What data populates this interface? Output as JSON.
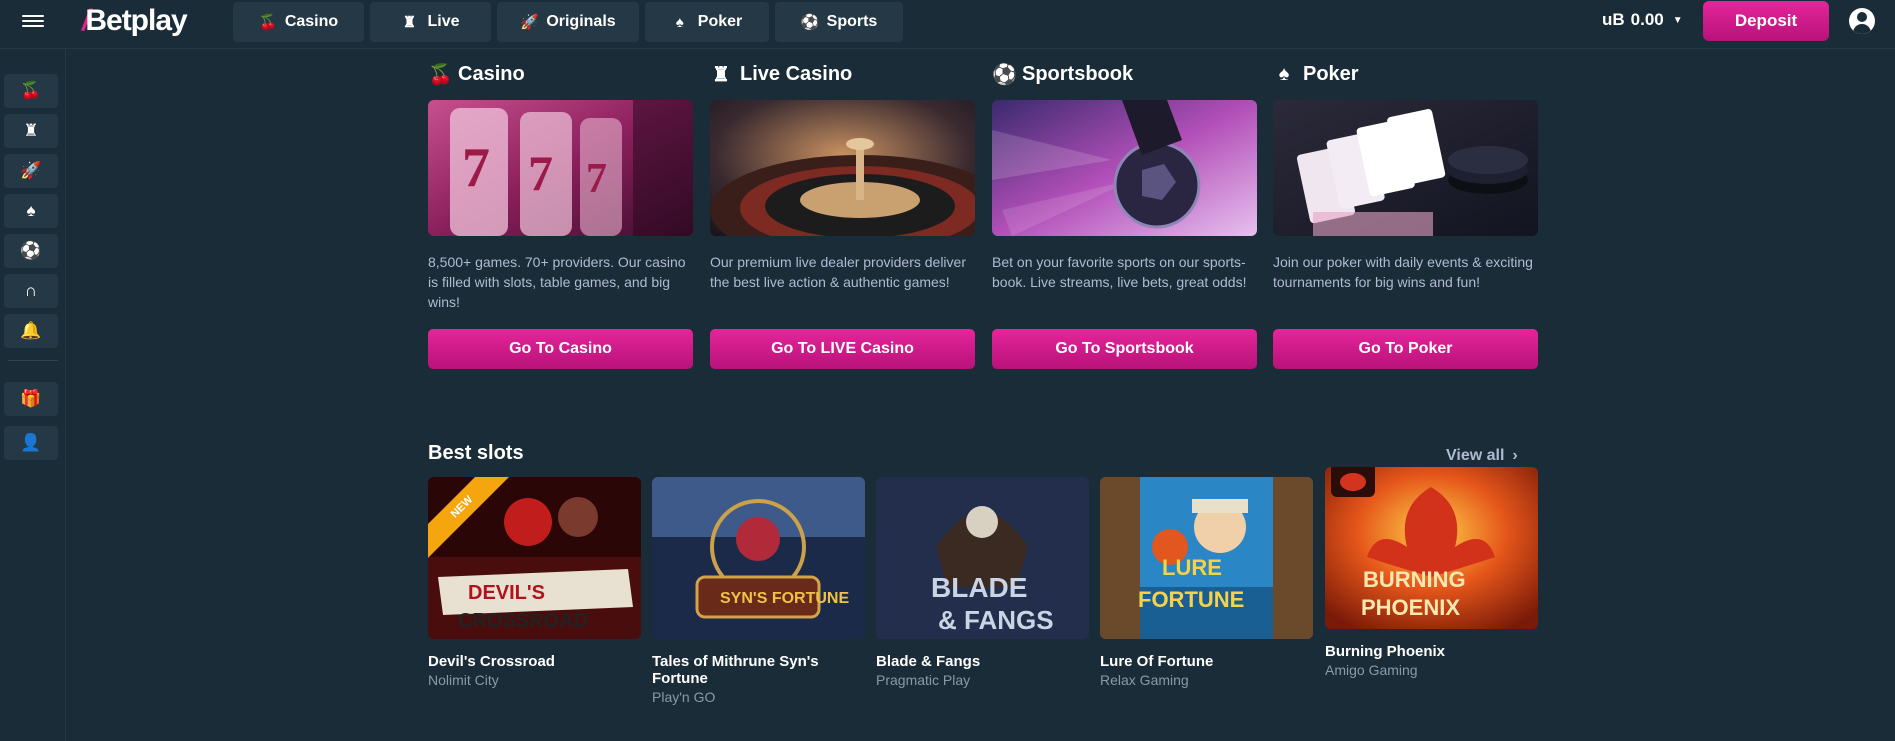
{
  "header": {
    "logo_text": "Betplay",
    "logo_bolt": "/",
    "nav": [
      {
        "label": "Casino",
        "icon": "cherries-icon",
        "glyph": "🍒"
      },
      {
        "label": "Live",
        "icon": "live-dealer-icon",
        "glyph": "♜"
      },
      {
        "label": "Originals",
        "icon": "rocket-icon",
        "glyph": "🚀"
      },
      {
        "label": "Poker",
        "icon": "spade-icon",
        "glyph": "♠"
      },
      {
        "label": "Sports",
        "icon": "ball-icon",
        "glyph": "⚽"
      }
    ],
    "balance": "uB 0.00",
    "currency_symbol": "uB",
    "balance_value": "0.00",
    "deposit_label": "Deposit"
  },
  "sidebar": {
    "items": [
      {
        "name": "cherries-icon",
        "glyph": "🍒"
      },
      {
        "name": "live-dealer-icon",
        "glyph": "♜"
      },
      {
        "name": "rocket-icon",
        "glyph": "🚀"
      },
      {
        "name": "spade-icon",
        "glyph": "♠"
      },
      {
        "name": "ball-icon",
        "glyph": "⚽"
      },
      {
        "name": "horseshoe-icon",
        "glyph": "∩"
      },
      {
        "name": "bell-icon",
        "glyph": "🔔"
      },
      {
        "name": "gift-icon",
        "glyph": "🎁"
      },
      {
        "name": "support-agent-icon",
        "glyph": "👤"
      }
    ]
  },
  "categories": [
    {
      "title": "Casino",
      "icon": "cherries-icon",
      "glyph": "🍒",
      "description": "8,500+ games. 70+ providers. Our casino is filled with slots, table games, and big wins!",
      "button": "Go To Casino"
    },
    {
      "title": "Live Casino",
      "icon": "live-dealer-icon",
      "glyph": "♜",
      "description": "Our premium live dealer providers deliver the best live action & authentic games!",
      "button": "Go To LIVE Casino"
    },
    {
      "title": "Sportsbook",
      "icon": "ball-icon",
      "glyph": "⚽",
      "description": "Bet on your favorite sports on our sports-book. Live streams, live bets, great odds!",
      "button": "Go To Sportsbook"
    },
    {
      "title": "Poker",
      "icon": "spade-icon",
      "glyph": "♠",
      "description": "Join our poker with daily events & exciting tournaments for big wins and fun!",
      "button": "Go To Poker"
    }
  ],
  "best_slots": {
    "title": "Best slots",
    "view_all": "View all",
    "games": [
      {
        "title": "Devil's Crossroad",
        "provider": "Nolimit City",
        "badge": "NEW",
        "art_text": "DEVIL'S CROSSROAD"
      },
      {
        "title": "Tales of Mithrune Syn's Fortune",
        "provider": "Play'n GO",
        "badge": "",
        "art_text": "SYN'S FORTUNE"
      },
      {
        "title": "Blade & Fangs",
        "provider": "Pragmatic Play",
        "badge": "",
        "art_text": "BLADE & FANGS"
      },
      {
        "title": "Lure Of Fortune",
        "provider": "Relax Gaming",
        "badge": "",
        "art_text": "LURE OF FORTUNE"
      },
      {
        "title": "Burning Phoenix",
        "provider": "Amigo Gaming",
        "badge": "",
        "art_text": "BURNING PHOENIX"
      }
    ]
  },
  "colors": {
    "background": "#1a2c38",
    "panel": "#243845",
    "accent": "#e0248d",
    "muted_text": "#b1bad3",
    "new_badge": "#f5a60f"
  }
}
